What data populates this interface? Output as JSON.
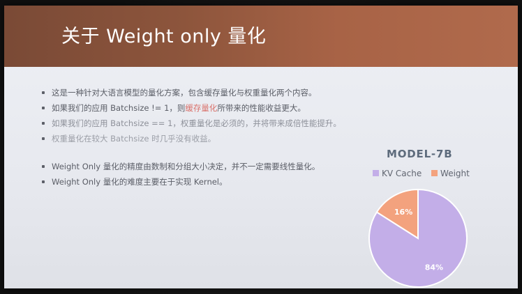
{
  "slide": {
    "title": "关于 Weight only 量化",
    "bullets_group1": [
      {
        "text": "这是一种针对大语言模型的量化方案，包含缓存量化与权重量化两个内容。"
      },
      {
        "pre": "如果我们的应用 Batchsize != 1，则",
        "highlight": "缓存量化",
        "post": "所带来的性能收益更大。"
      },
      {
        "text": "如果我们的应用 Batchsize == 1，权重量化是必须的，并将带来成倍性能提升。"
      },
      {
        "text": "权重量化在较大 Batchsize 时几乎没有收益。"
      }
    ],
    "bullets_group2": [
      {
        "text": "Weight Only 量化的精度由数制和分组大小决定，并不一定需要线性量化。"
      },
      {
        "text": "Weight Only 量化的难度主要在于实现 Kernel。"
      }
    ],
    "colors": {
      "title_bar": "#8d553c",
      "highlight": "#d9706a"
    }
  },
  "chart_data": {
    "type": "pie",
    "title": "MODEL-7B",
    "legend": "top",
    "series": [
      {
        "name": "KV Cache",
        "value": 84,
        "label": "84%",
        "color": "#c3aee8"
      },
      {
        "name": "Weight",
        "value": 16,
        "label": "16%",
        "color": "#f3a27e"
      }
    ]
  }
}
